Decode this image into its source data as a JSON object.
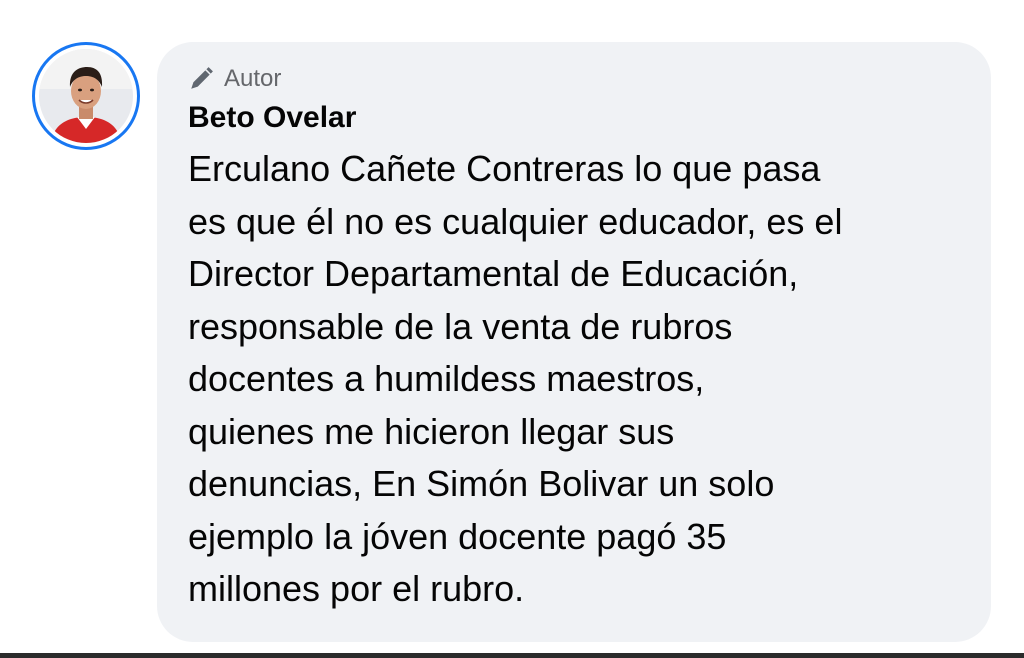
{
  "comment": {
    "author_badge": "Autor",
    "author_name": "Beto Ovelar",
    "text": "Erculano Cañete Contreras lo que pasa\nes que él no es cualquier educador, es el\nDirector Departamental de Educación,\nresponsable de la venta de rubros\ndocentes a humildess maestros,\nquienes me hicieron llegar sus\ndenuncias, En Simón Bolivar un solo\nejemplo la jóven docente pagó 35\nmillones por el rubro."
  },
  "icons": {
    "badge": "pencil-icon",
    "avatar": "profile-photo"
  },
  "colors": {
    "bubble_background": "#f0f2f5",
    "avatar_ring": "#1877f2",
    "text": "#050505",
    "secondary_text": "#65676b",
    "shirt": "#d62828"
  }
}
